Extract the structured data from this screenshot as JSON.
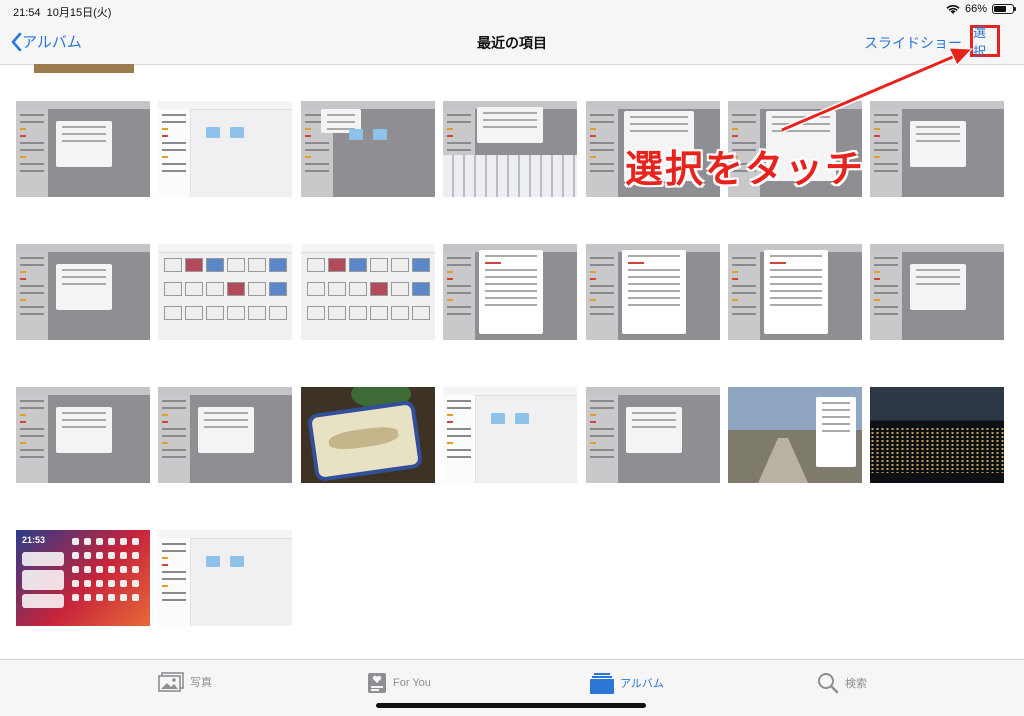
{
  "status_bar": {
    "time": "21:54",
    "date": "10月15日(火)",
    "battery": "66%",
    "battery_level": 0.66
  },
  "nav": {
    "back_label": "アルバム",
    "title": "最近の項目",
    "slideshow_label": "スライドショー",
    "select_label": "選択"
  },
  "annotation": {
    "text": "選択をタッチ",
    "color": "#e8231d"
  },
  "colors": {
    "accent": "#2b77d8",
    "annotation": "#e8231d"
  },
  "photos": [
    {
      "kind": "screenshot-dialog"
    },
    {
      "kind": "screenshot-files"
    },
    {
      "kind": "screenshot-menu"
    },
    {
      "kind": "screenshot-keyboard"
    },
    {
      "kind": "screenshot-gray"
    },
    {
      "kind": "screenshot-gray"
    },
    {
      "kind": "screenshot-dialog"
    },
    {
      "kind": "screenshot-dialog"
    },
    {
      "kind": "screenshot-grid"
    },
    {
      "kind": "screenshot-grid"
    },
    {
      "kind": "screenshot-share"
    },
    {
      "kind": "screenshot-share"
    },
    {
      "kind": "screenshot-share"
    },
    {
      "kind": "screenshot-dialog"
    },
    {
      "kind": "screenshot-dialog"
    },
    {
      "kind": "screenshot-dialog"
    },
    {
      "kind": "photo-food"
    },
    {
      "kind": "screenshot-files"
    },
    {
      "kind": "screenshot-dialog"
    },
    {
      "kind": "photo-road"
    },
    {
      "kind": "photo-night"
    },
    {
      "kind": "screenshot-home",
      "clock": "21:53"
    },
    {
      "kind": "screenshot-files"
    }
  ],
  "tab_bar": {
    "tabs": [
      {
        "label": "写真",
        "icon": "photos-icon",
        "active": false
      },
      {
        "label": "For You",
        "icon": "for-you-icon",
        "active": false
      },
      {
        "label": "アルバム",
        "icon": "albums-icon",
        "active": true
      },
      {
        "label": "検索",
        "icon": "search-icon",
        "active": false
      }
    ]
  }
}
